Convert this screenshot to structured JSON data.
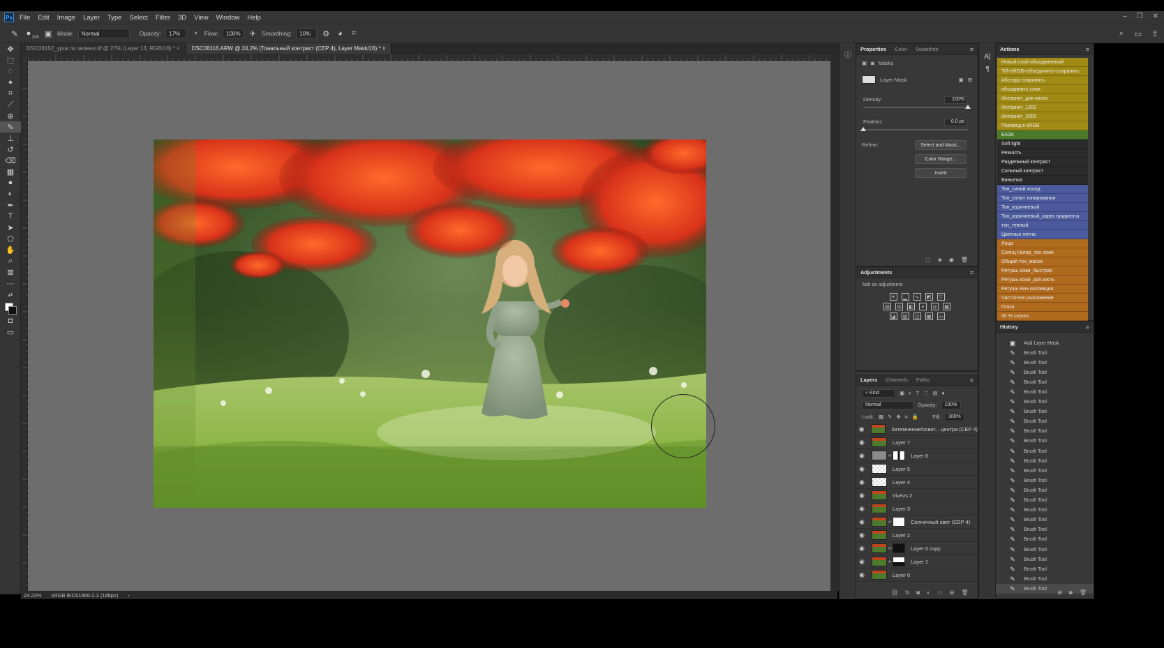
{
  "app": {
    "logo": "Ps"
  },
  "menu": [
    "File",
    "Edit",
    "Image",
    "Layer",
    "Type",
    "Select",
    "Filter",
    "3D",
    "View",
    "Window",
    "Help"
  ],
  "options": {
    "mode_label": "Mode:",
    "mode_value": "Normal",
    "opacity_label": "Opacity:",
    "opacity_value": "17%",
    "flow_label": "Flow:",
    "flow_value": "100%",
    "smoothing_label": "Smoothing:",
    "smoothing_value": "10%",
    "brush_size": "300"
  },
  "tabs": [
    {
      "label": "DSC08152_урок по зелени.tif @ 27% (Layer 13, RGB/16) *"
    },
    {
      "label": "DSC08116.ARW @ 24,2% (Тональный контраст (CEP 4), Layer Mask/16) *"
    }
  ],
  "status": {
    "zoom": "24.23%",
    "profile": "sRGB IEC61966-2.1 (16bpc)"
  },
  "properties": {
    "tabs": [
      "Properties",
      "Color",
      "Swatches"
    ],
    "section": "Masks",
    "mask_label": "Layer Mask",
    "density_label": "Density:",
    "density_value": "100%",
    "density_level": 1.0,
    "feather_label": "Feather:",
    "feather_value": "0.0 px",
    "feather_level": 0.0,
    "refine_label": "Refine:",
    "select_mask_btn": "Select and Mask...",
    "color_range_btn": "Color Range...",
    "invert_btn": "Invert"
  },
  "adjustments": {
    "title": "Adjustments",
    "hint": "Add an adjustment"
  },
  "layers": {
    "tabs": [
      "Layers",
      "Channels",
      "Paths"
    ],
    "kind_label": "Kind",
    "blend_mode": "Normal",
    "opacity_label": "Opacity:",
    "opacity_value": "100%",
    "lock_label": "Lock:",
    "fill_label": "Fill:",
    "fill_value": "100%",
    "items": [
      {
        "name": "Затемнение/освет... центра (CEP 4)",
        "thumb": "photo",
        "mask": ""
      },
      {
        "name": "Layer 7",
        "thumb": "photo",
        "mask": ""
      },
      {
        "name": "Layer 6",
        "thumb": "gray",
        "mask": "bw"
      },
      {
        "name": "Layer 5",
        "thumb": "transparent",
        "mask": ""
      },
      {
        "name": "Layer 4",
        "thumb": "transparent",
        "mask": ""
      },
      {
        "name": "Vivezs 2",
        "thumb": "photo",
        "mask": ""
      },
      {
        "name": "Layer 3",
        "thumb": "photo",
        "mask": ""
      },
      {
        "name": "Солнечный свет (CEP 4)",
        "thumb": "photo",
        "mask": "white"
      },
      {
        "name": "Layer 2",
        "thumb": "photo",
        "mask": ""
      },
      {
        "name": "Layer 0 copy",
        "thumb": "photo",
        "mask": "black"
      },
      {
        "name": "Layer 1",
        "thumb": "photo",
        "mask": "whitebw"
      },
      {
        "name": "Layer 0",
        "thumb": "photo",
        "mask": ""
      }
    ]
  },
  "actions": {
    "title": "Actions",
    "items": [
      {
        "label": "Новый слой объединенный",
        "color": "#a08a14"
      },
      {
        "label": "Tiff+sRGB+объединить+сохранить",
        "color": "#a08a14"
      },
      {
        "label": "Абстарр сохранить",
        "color": "#a08a14"
      },
      {
        "label": "объединить слои",
        "color": "#a08a14"
      },
      {
        "label": "Интернет_для кисти",
        "color": "#a08a14"
      },
      {
        "label": "Интернет_1200",
        "color": "#a08a14"
      },
      {
        "label": "Интернет_2000",
        "color": "#a08a14"
      },
      {
        "label": "Перевод в sRGB",
        "color": "#a08a14"
      },
      {
        "label": "БАЗА",
        "color": "#4a7a2a"
      },
      {
        "label": "Soft light",
        "color": "#2b2b2b"
      },
      {
        "label": "Резкость",
        "color": "#2b2b2b"
      },
      {
        "label": "Раздельный контраст",
        "color": "#2b2b2b"
      },
      {
        "label": "Сильный контраст",
        "color": "#2b2b2b"
      },
      {
        "label": "Виньетка",
        "color": "#2b2b2b"
      },
      {
        "label": "Тон_синий холод",
        "color": "#4a5a9c"
      },
      {
        "label": "Тон_сплит тонирования",
        "color": "#4a5a9c"
      },
      {
        "label": "Тон_коричневый",
        "color": "#4a5a9c"
      },
      {
        "label": "Тон_коричневый_карта градиента",
        "color": "#4a5a9c"
      },
      {
        "label": "тон_теплый",
        "color": "#4a5a9c"
      },
      {
        "label": "Цветные пятна",
        "color": "#4a5a9c"
      },
      {
        "label": "Лица",
        "color": "#b06a1e"
      },
      {
        "label": "Солнц Колор_тон кожи",
        "color": "#b06a1e"
      },
      {
        "label": "Общий тон_маска",
        "color": "#b06a1e"
      },
      {
        "label": "Ретушь кожи_быстрая",
        "color": "#b06a1e"
      },
      {
        "label": "Ретушь кожи_доп.кисть",
        "color": "#b06a1e"
      },
      {
        "label": "Ретушь Нин коллекция",
        "color": "#b06a1e"
      },
      {
        "label": "Частотное разложение",
        "color": "#b06a1e"
      },
      {
        "label": "Глаза",
        "color": "#b06a1e"
      },
      {
        "label": "50 % серого",
        "color": "#b06a1e"
      }
    ]
  },
  "history": {
    "title": "History",
    "items": [
      "Add Layer Mask",
      "Brush Tool",
      "Brush Tool",
      "Brush Tool",
      "Brush Tool",
      "Brush Tool",
      "Brush Tool",
      "Brush Tool",
      "Brush Tool",
      "Brush Tool",
      "Brush Tool",
      "Brush Tool",
      "Brush Tool",
      "Brush Tool",
      "Brush Tool",
      "Brush Tool",
      "Brush Tool",
      "Brush Tool",
      "Brush Tool",
      "Brush Tool",
      "Brush Tool",
      "Brush Tool",
      "Brush Tool",
      "Brush Tool",
      "Brush Tool",
      "Brush Tool"
    ]
  }
}
